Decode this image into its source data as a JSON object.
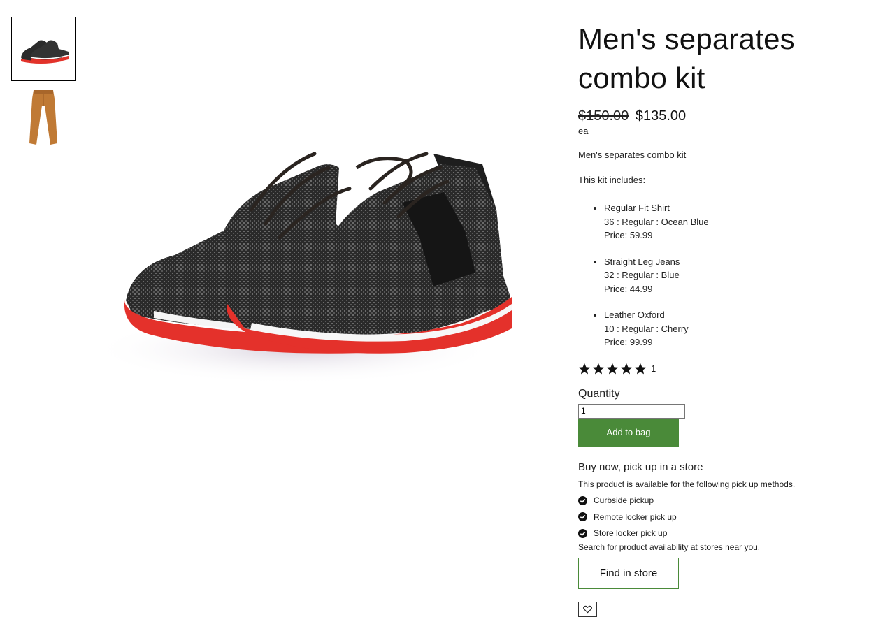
{
  "gallery": {
    "thumbnails": [
      {
        "icon": "sneaker-thumbnail",
        "selected": true
      },
      {
        "icon": "pants-thumbnail",
        "selected": false
      }
    ],
    "main_image": "sneaker-pair-image"
  },
  "product": {
    "title": "Men's separates combo kit",
    "price_original": "$150.00",
    "price_current": "$135.00",
    "unit": "ea",
    "description": "Men's separates combo kit",
    "includes_label": "This kit includes:",
    "items": [
      {
        "name": "Regular Fit Shirt",
        "variant": "36 : Regular : Ocean Blue",
        "price": "Price: 59.99"
      },
      {
        "name": "Straight Leg Jeans",
        "variant": "32 : Regular : Blue",
        "price": "Price: 44.99"
      },
      {
        "name": "Leather Oxford",
        "variant": "10 : Regular : Cherry",
        "price": "Price: 99.99"
      }
    ],
    "rating": {
      "stars": 5,
      "count": "1"
    }
  },
  "purchase": {
    "quantity_label": "Quantity",
    "quantity_value": "1",
    "add_to_bag_label": "Add to bag",
    "accent_color": "#4a8a39"
  },
  "pickup": {
    "heading": "Buy now, pick up in a store",
    "description": "This product is available for the following pick up methods.",
    "methods": [
      "Curbside pickup",
      "Remote locker pick up",
      "Store locker pick up"
    ],
    "search_text": "Search for product availability at stores near you.",
    "find_label": "Find in store"
  },
  "wishlist": {
    "icon": "heart-icon"
  }
}
